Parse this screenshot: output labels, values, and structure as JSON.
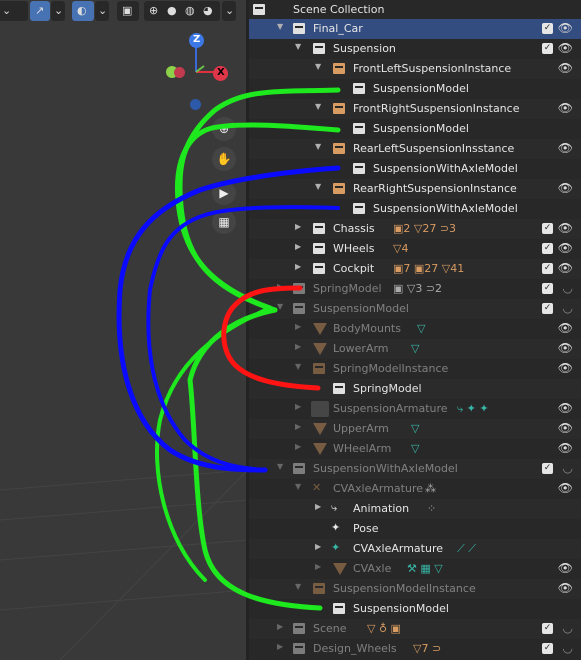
{
  "outliner": {
    "rows": [
      {
        "label": "Scene Collection"
      },
      {
        "label": "Final_Car"
      },
      {
        "label": "Suspension"
      },
      {
        "label": "FrontLeftSuspensionInstance"
      },
      {
        "label": "SuspensionModel"
      },
      {
        "label": "FrontRightSuspensionInstance"
      },
      {
        "label": "SuspensionModel"
      },
      {
        "label": "RearLeftSuspensionInsstance"
      },
      {
        "label": "SuspensionWithAxleModel"
      },
      {
        "label": "RearRightSuspensionInstance"
      },
      {
        "label": "SuspensionWithAxleModel"
      },
      {
        "label": "Chassis",
        "extra": "▣2 ▽27 ⊃3"
      },
      {
        "label": "WHeels",
        "extra": "▽4"
      },
      {
        "label": "Cockpit",
        "extra": "▣7 ▣27 ▽41"
      },
      {
        "label": "SpringModel",
        "extra": "▣ ▽3 ⊃2"
      },
      {
        "label": "SuspensionModel"
      },
      {
        "label": "BodyMounts"
      },
      {
        "label": "LowerArm"
      },
      {
        "label": "SpringModelInstance"
      },
      {
        "label": "SpringModel"
      },
      {
        "label": "SuspensionArmature"
      },
      {
        "label": "UpperArm"
      },
      {
        "label": "WHeelArm"
      },
      {
        "label": "SuspensionWithAxleModel"
      },
      {
        "label": "CVAxleArmature"
      },
      {
        "label": "Animation"
      },
      {
        "label": "Pose"
      },
      {
        "label": "CVAxleArmature"
      },
      {
        "label": "CVAxle"
      },
      {
        "label": "SuspensionModelInstance"
      },
      {
        "label": "SuspensionModel"
      },
      {
        "label": "Scene",
        "extra": "▽ ♁ ▣"
      },
      {
        "label": "Design_Wheels",
        "extra": "▽7 ⊃"
      }
    ]
  },
  "gizmo": {
    "z": "Z",
    "x": "X"
  },
  "colors": {
    "green": "#1ee81e",
    "blue": "#0a0aff",
    "red": "#ff1414",
    "selected": "#334d80"
  }
}
